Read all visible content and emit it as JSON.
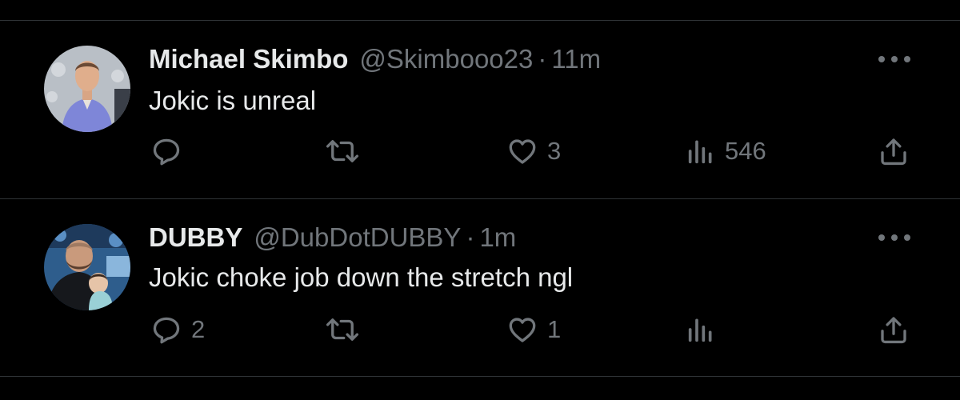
{
  "tweets": [
    {
      "name": "Michael Skimbo",
      "handle": "@Skimbooo23",
      "separator": "·",
      "time": "11m",
      "text": "Jokic is unreal",
      "avatar_icon": "profile-photo-man",
      "replies": "",
      "retweets": "",
      "likes": "3",
      "views": "546"
    },
    {
      "name": "DUBBY",
      "handle": "@DubDotDUBBY",
      "separator": "·",
      "time": "1m",
      "text": "Jokic choke job down the stretch ngl",
      "avatar_icon": "profile-photo-man-with-child",
      "replies": "2",
      "retweets": "",
      "likes": "1",
      "views": ""
    }
  ],
  "icons": {
    "reply": "reply-icon",
    "retweet": "retweet-icon",
    "like": "like-icon",
    "views": "views-icon",
    "share": "share-icon",
    "more": "more-icon"
  },
  "colors": {
    "background": "#000000",
    "primary_text": "#e7e9ea",
    "secondary_text": "#71767b",
    "divider": "#2f3336"
  }
}
